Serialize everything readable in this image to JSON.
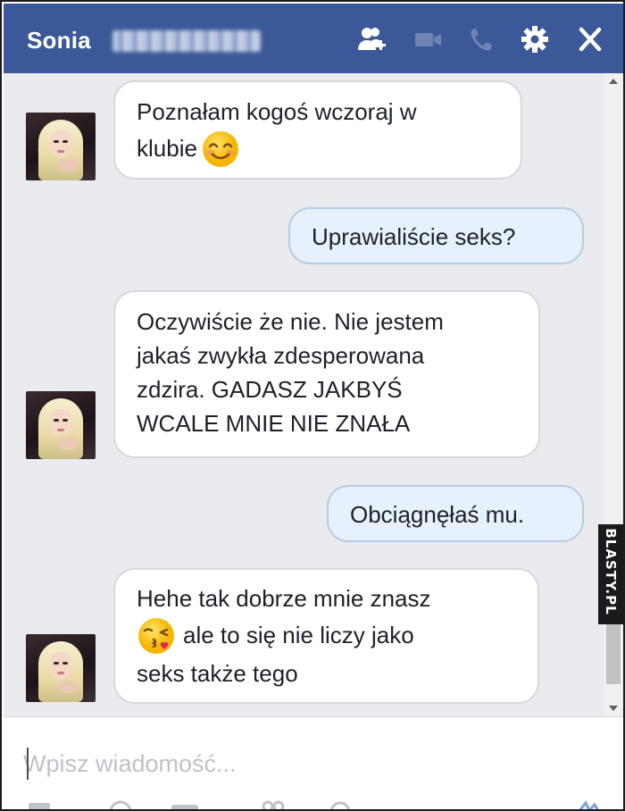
{
  "header": {
    "first_name": "Sonia",
    "icons": [
      "add-friend-icon",
      "video-call-icon",
      "phone-call-icon",
      "settings-gear-icon",
      "close-icon"
    ]
  },
  "messages": [
    {
      "direction": "in",
      "text_parts": [
        "Poznałam kogoś wczoraj w",
        "klubie"
      ],
      "emoji": "smiling-face-icon"
    },
    {
      "direction": "out",
      "text": "Uprawialiście seks?"
    },
    {
      "direction": "in",
      "lines": [
        "Oczywiście że nie. Nie jestem",
        "jakaś zwykła zdesperowana",
        "zdzira. GADASZ JAKBYŚ",
        "WCALE MNIE NIE ZNAŁA"
      ]
    },
    {
      "direction": "out",
      "text": "Obciągnęłaś mu."
    },
    {
      "direction": "in",
      "lines": [
        "Hehe tak dobrze mnie znasz",
        "ale to się nie liczy jako",
        "seks także tego"
      ],
      "emoji": "kissing-face-icon"
    }
  ],
  "composer": {
    "placeholder": "Wpisz wiadomość..."
  },
  "watermark": "BLASTY.PL",
  "colors": {
    "header": "#3b5998",
    "chat_bg": "#e9ebee",
    "outgoing_bubble": "#e7f0fd",
    "incoming_bubble": "#ffffff"
  }
}
